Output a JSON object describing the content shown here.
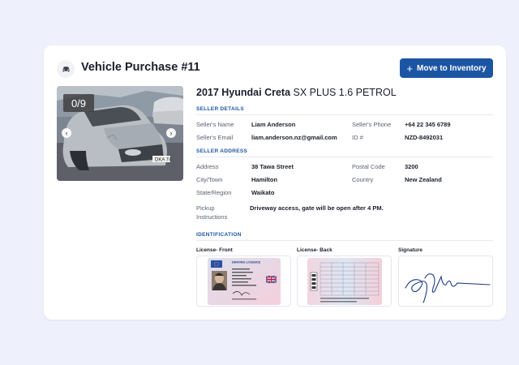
{
  "header": {
    "title": "Vehicle Purchase #11",
    "icon": "car-icon"
  },
  "actions": {
    "move_label": "Move to Inventory"
  },
  "photo": {
    "counter": "0/9"
  },
  "vehicle": {
    "name_bold": "2017 Hyundai Creta",
    "name_rest": " SX PLUS 1.6 PETROL"
  },
  "seller_details": {
    "heading": "SELLER DETAILS",
    "name_label": "Seller's Name",
    "name": "Liam Anderson",
    "phone_label": "Seller's Phone",
    "phone": "+64 22 345 6789",
    "email_label": "Seller's Email",
    "email": "liam.anderson.nz@gmail.com",
    "id_label": "ID #",
    "id": "NZD-8492031"
  },
  "seller_address": {
    "heading": "SELLER ADDRESS",
    "address_label": "Address",
    "address": "38 Tawa Street",
    "postal_label": "Postal Code",
    "postal": "3200",
    "city_label": "City/Town",
    "city": "Hamilton",
    "country_label": "Country",
    "country": "New Zealand",
    "state_label": "State/Region",
    "state": "Waikato",
    "pickup_label_1": "Pickup",
    "pickup_label_2": "Instructions",
    "pickup": "Driveway access, gate will be open after 4 PM."
  },
  "identification": {
    "heading": "IDENTIFICATION",
    "front_label": "License- Front",
    "back_label": "License- Back",
    "signature_label": "Signature",
    "license_header": "DRIVING LICENCE"
  },
  "colors": {
    "accent": "#1d55a5",
    "background": "#eef1fb"
  }
}
